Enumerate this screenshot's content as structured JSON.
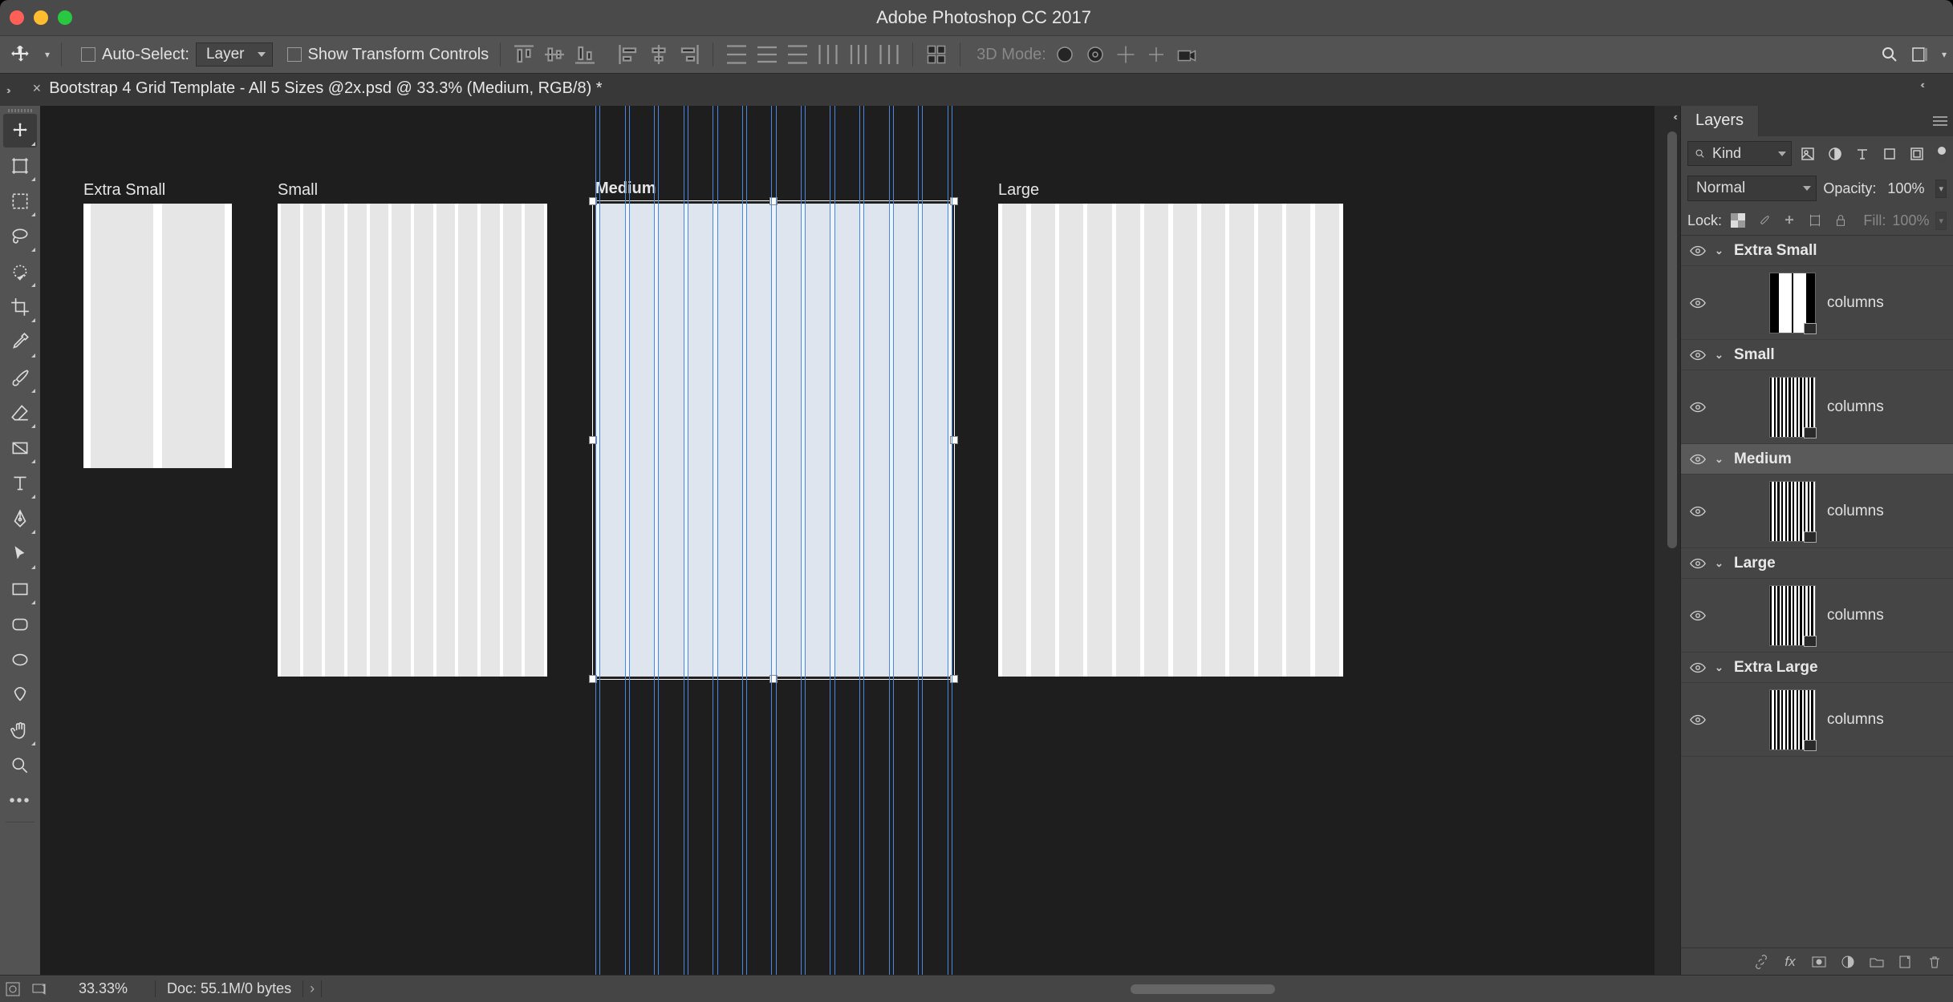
{
  "titlebar": {
    "title": "Adobe Photoshop CC 2017"
  },
  "optbar": {
    "auto_select_label": "Auto-Select:",
    "target_select": "Layer",
    "show_transform_label": "Show Transform Controls",
    "mode3d_label": "3D Mode:"
  },
  "tab": {
    "title": "Bootstrap 4 Grid Template - All 5 Sizes @2x.psd @ 33.3% (Medium, RGB/8) *"
  },
  "artboards": {
    "xs_label": "Extra Small",
    "sm_label": "Small",
    "md_label": "Medium",
    "lg_label": "Large"
  },
  "layers_panel": {
    "tab_label": "Layers",
    "kind_label": "Kind",
    "blend_mode": "Normal",
    "opacity_label": "Opacity:",
    "opacity_value": "100%",
    "lock_label": "Lock:",
    "fill_label": "Fill:",
    "fill_value": "100%",
    "groups": [
      {
        "name": "Extra Small",
        "child": "columns"
      },
      {
        "name": "Small",
        "child": "columns"
      },
      {
        "name": "Medium",
        "child": "columns"
      },
      {
        "name": "Large",
        "child": "columns"
      },
      {
        "name": "Extra Large",
        "child": "columns"
      }
    ]
  },
  "statusbar": {
    "zoom": "33.33%",
    "doc_info": "Doc: 55.1M/0 bytes"
  }
}
